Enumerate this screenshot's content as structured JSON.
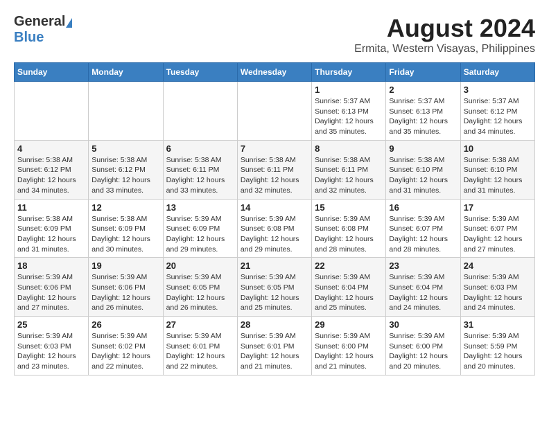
{
  "header": {
    "logo_general": "General",
    "logo_blue": "Blue",
    "title": "August 2024",
    "subtitle": "Ermita, Western Visayas, Philippines"
  },
  "calendar": {
    "days_of_week": [
      "Sunday",
      "Monday",
      "Tuesday",
      "Wednesday",
      "Thursday",
      "Friday",
      "Saturday"
    ],
    "weeks": [
      {
        "row_bg": "white",
        "days": [
          {
            "num": "",
            "info": ""
          },
          {
            "num": "",
            "info": ""
          },
          {
            "num": "",
            "info": ""
          },
          {
            "num": "",
            "info": ""
          },
          {
            "num": "1",
            "info": "Sunrise: 5:37 AM\nSunset: 6:13 PM\nDaylight: 12 hours\nand 35 minutes."
          },
          {
            "num": "2",
            "info": "Sunrise: 5:37 AM\nSunset: 6:13 PM\nDaylight: 12 hours\nand 35 minutes."
          },
          {
            "num": "3",
            "info": "Sunrise: 5:37 AM\nSunset: 6:12 PM\nDaylight: 12 hours\nand 34 minutes."
          }
        ]
      },
      {
        "row_bg": "light",
        "days": [
          {
            "num": "4",
            "info": "Sunrise: 5:38 AM\nSunset: 6:12 PM\nDaylight: 12 hours\nand 34 minutes."
          },
          {
            "num": "5",
            "info": "Sunrise: 5:38 AM\nSunset: 6:12 PM\nDaylight: 12 hours\nand 33 minutes."
          },
          {
            "num": "6",
            "info": "Sunrise: 5:38 AM\nSunset: 6:11 PM\nDaylight: 12 hours\nand 33 minutes."
          },
          {
            "num": "7",
            "info": "Sunrise: 5:38 AM\nSunset: 6:11 PM\nDaylight: 12 hours\nand 32 minutes."
          },
          {
            "num": "8",
            "info": "Sunrise: 5:38 AM\nSunset: 6:11 PM\nDaylight: 12 hours\nand 32 minutes."
          },
          {
            "num": "9",
            "info": "Sunrise: 5:38 AM\nSunset: 6:10 PM\nDaylight: 12 hours\nand 31 minutes."
          },
          {
            "num": "10",
            "info": "Sunrise: 5:38 AM\nSunset: 6:10 PM\nDaylight: 12 hours\nand 31 minutes."
          }
        ]
      },
      {
        "row_bg": "white",
        "days": [
          {
            "num": "11",
            "info": "Sunrise: 5:38 AM\nSunset: 6:09 PM\nDaylight: 12 hours\nand 31 minutes."
          },
          {
            "num": "12",
            "info": "Sunrise: 5:38 AM\nSunset: 6:09 PM\nDaylight: 12 hours\nand 30 minutes."
          },
          {
            "num": "13",
            "info": "Sunrise: 5:39 AM\nSunset: 6:09 PM\nDaylight: 12 hours\nand 29 minutes."
          },
          {
            "num": "14",
            "info": "Sunrise: 5:39 AM\nSunset: 6:08 PM\nDaylight: 12 hours\nand 29 minutes."
          },
          {
            "num": "15",
            "info": "Sunrise: 5:39 AM\nSunset: 6:08 PM\nDaylight: 12 hours\nand 28 minutes."
          },
          {
            "num": "16",
            "info": "Sunrise: 5:39 AM\nSunset: 6:07 PM\nDaylight: 12 hours\nand 28 minutes."
          },
          {
            "num": "17",
            "info": "Sunrise: 5:39 AM\nSunset: 6:07 PM\nDaylight: 12 hours\nand 27 minutes."
          }
        ]
      },
      {
        "row_bg": "light",
        "days": [
          {
            "num": "18",
            "info": "Sunrise: 5:39 AM\nSunset: 6:06 PM\nDaylight: 12 hours\nand 27 minutes."
          },
          {
            "num": "19",
            "info": "Sunrise: 5:39 AM\nSunset: 6:06 PM\nDaylight: 12 hours\nand 26 minutes."
          },
          {
            "num": "20",
            "info": "Sunrise: 5:39 AM\nSunset: 6:05 PM\nDaylight: 12 hours\nand 26 minutes."
          },
          {
            "num": "21",
            "info": "Sunrise: 5:39 AM\nSunset: 6:05 PM\nDaylight: 12 hours\nand 25 minutes."
          },
          {
            "num": "22",
            "info": "Sunrise: 5:39 AM\nSunset: 6:04 PM\nDaylight: 12 hours\nand 25 minutes."
          },
          {
            "num": "23",
            "info": "Sunrise: 5:39 AM\nSunset: 6:04 PM\nDaylight: 12 hours\nand 24 minutes."
          },
          {
            "num": "24",
            "info": "Sunrise: 5:39 AM\nSunset: 6:03 PM\nDaylight: 12 hours\nand 24 minutes."
          }
        ]
      },
      {
        "row_bg": "white",
        "days": [
          {
            "num": "25",
            "info": "Sunrise: 5:39 AM\nSunset: 6:03 PM\nDaylight: 12 hours\nand 23 minutes."
          },
          {
            "num": "26",
            "info": "Sunrise: 5:39 AM\nSunset: 6:02 PM\nDaylight: 12 hours\nand 22 minutes."
          },
          {
            "num": "27",
            "info": "Sunrise: 5:39 AM\nSunset: 6:01 PM\nDaylight: 12 hours\nand 22 minutes."
          },
          {
            "num": "28",
            "info": "Sunrise: 5:39 AM\nSunset: 6:01 PM\nDaylight: 12 hours\nand 21 minutes."
          },
          {
            "num": "29",
            "info": "Sunrise: 5:39 AM\nSunset: 6:00 PM\nDaylight: 12 hours\nand 21 minutes."
          },
          {
            "num": "30",
            "info": "Sunrise: 5:39 AM\nSunset: 6:00 PM\nDaylight: 12 hours\nand 20 minutes."
          },
          {
            "num": "31",
            "info": "Sunrise: 5:39 AM\nSunset: 5:59 PM\nDaylight: 12 hours\nand 20 minutes."
          }
        ]
      }
    ]
  }
}
